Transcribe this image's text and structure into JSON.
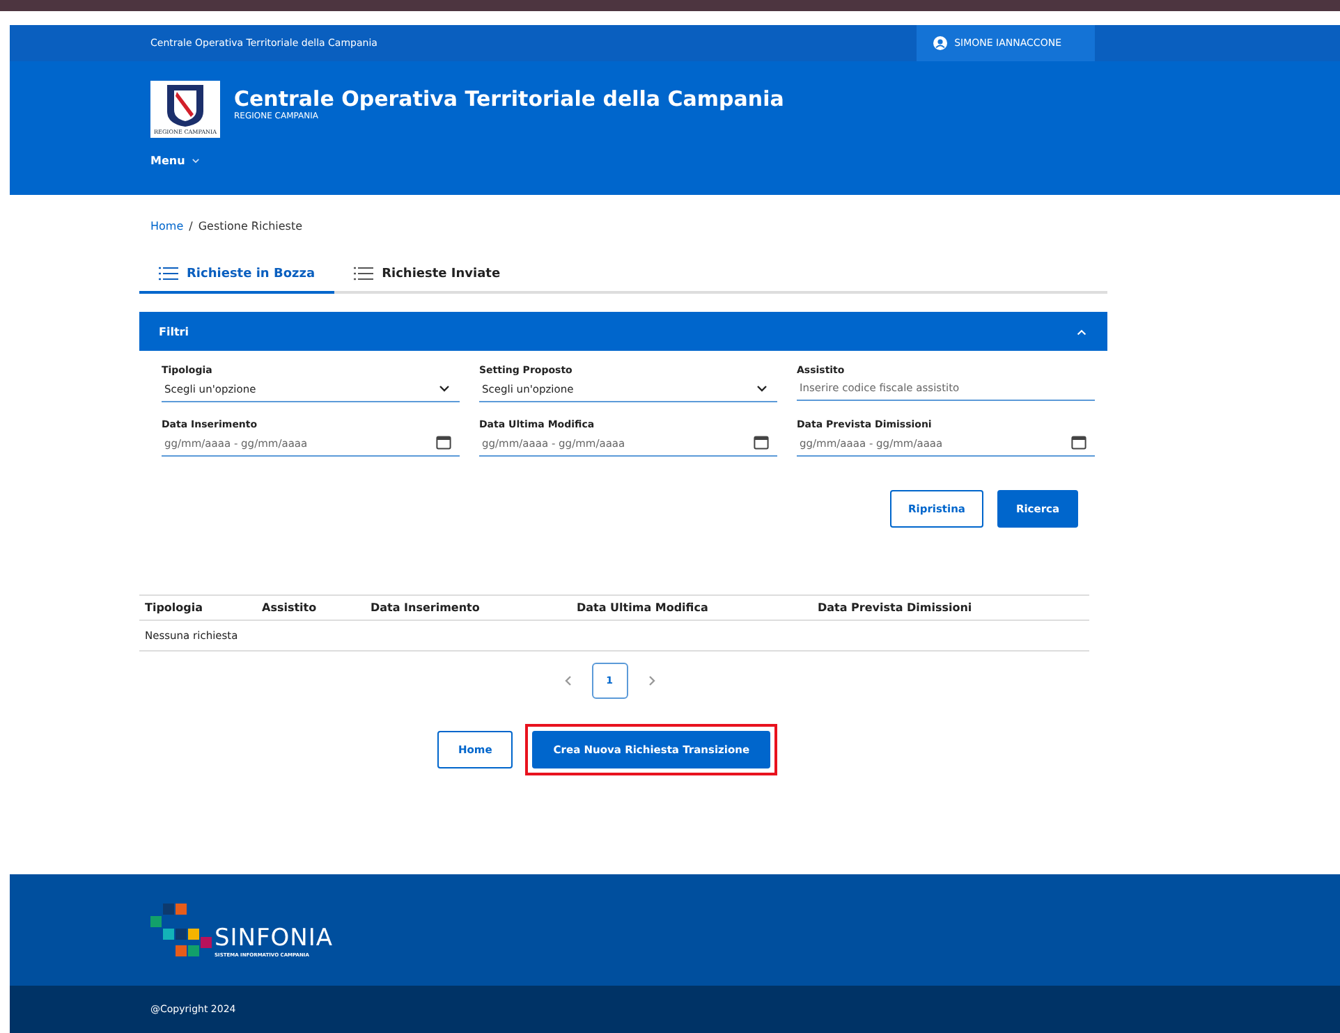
{
  "top_bar": {
    "site_name": "Centrale Operativa Territoriale della Campania",
    "user": "SIMONE IANNACCONE"
  },
  "header": {
    "emblem_caption": "REGIONE CAMPANIA",
    "title": "Centrale Operativa Territoriale della Campania",
    "subtitle": "REGIONE CAMPANIA",
    "menu": "Menu"
  },
  "breadcrumb": {
    "separator": "/",
    "items": [
      {
        "label": "Home",
        "kind": "link"
      },
      {
        "label": "Gestione Richieste",
        "kind": "current"
      }
    ]
  },
  "tabs": [
    {
      "label": "Richieste in Bozza",
      "selected": true
    },
    {
      "label": "Richieste Inviate",
      "selected": false
    }
  ],
  "filters": {
    "title": "Filtri",
    "expanded": true,
    "fields": [
      {
        "label": "Tipologia",
        "kind": "select",
        "value": "Scegli un'opzione"
      },
      {
        "label": "Setting Proposto",
        "kind": "select",
        "value": "Scegli un'opzione"
      },
      {
        "label": "Assistito",
        "kind": "text",
        "placeholder": "Inserire codice fiscale assistito"
      },
      {
        "label": "Data Inserimento",
        "kind": "date",
        "placeholder": "gg/mm/aaaa - gg/mm/aaaa"
      },
      {
        "label": "Data Ultima Modifica",
        "kind": "date",
        "placeholder": "gg/mm/aaaa - gg/mm/aaaa"
      },
      {
        "label": "Data Prevista Dimissioni",
        "kind": "date",
        "placeholder": "gg/mm/aaaa - gg/mm/aaaa"
      }
    ],
    "buttons": [
      {
        "label": "Ripristina",
        "kind": "outline"
      },
      {
        "label": "Ricerca",
        "kind": "primary"
      }
    ]
  },
  "table": {
    "columns": [
      "Tipologia",
      "Assistito",
      "Data Inserimento",
      "Data Ultima Modifica",
      "Data Prevista Dimissioni"
    ],
    "empty_message": "Nessuna richiesta"
  },
  "pagination": {
    "pages": [
      {
        "label": "1",
        "selected": true
      }
    ]
  },
  "actions": [
    {
      "label": "Home",
      "kind": "outline",
      "highlighted": false
    },
    {
      "label": "Crea Nuova Richiesta Transizione",
      "kind": "primary",
      "highlighted": true
    }
  ],
  "footer": {
    "logo_name": "SINFONIA",
    "logo_tagline": "SISTEMA INFORMATIVO CAMPANIA",
    "copyright": "@Copyright 2024"
  }
}
